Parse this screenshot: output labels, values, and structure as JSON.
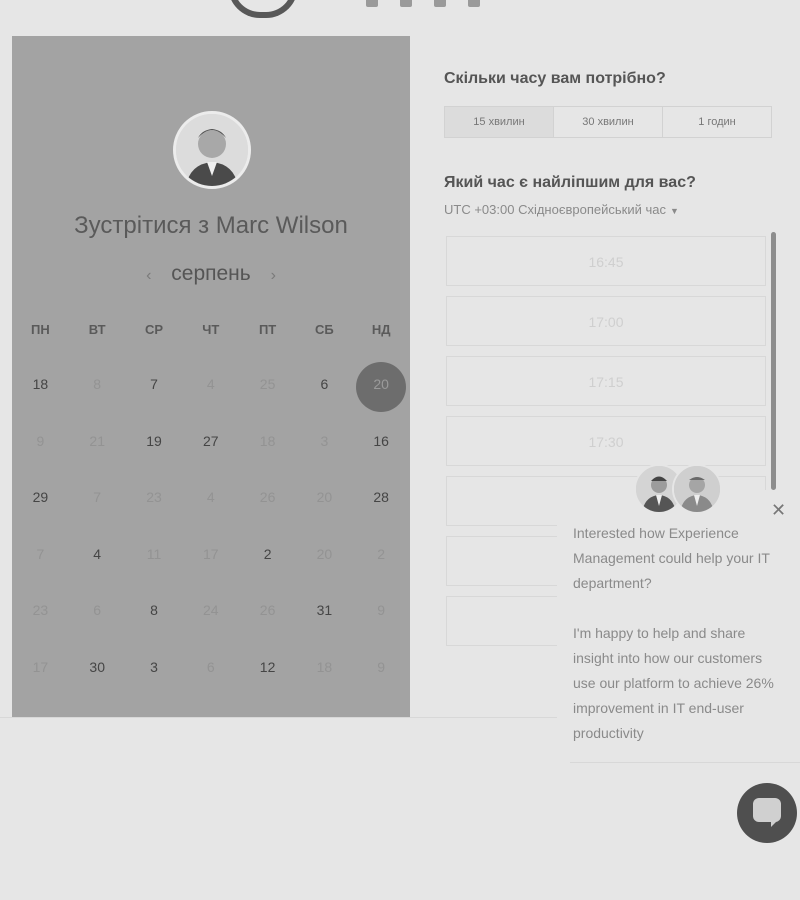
{
  "header": {
    "logo": "logo-icon"
  },
  "calendar": {
    "title": "Зустрітися з Marc Wilson",
    "month": "серпень",
    "prev": "‹",
    "next": "›",
    "weekdays": [
      "ПН",
      "ВТ",
      "СР",
      "ЧТ",
      "ПТ",
      "СБ",
      "НД"
    ],
    "weeks": [
      [
        {
          "d": "18",
          "s": "avail"
        },
        {
          "d": "8",
          "s": "dim"
        },
        {
          "d": "7",
          "s": "avail"
        },
        {
          "d": "4",
          "s": "dim"
        },
        {
          "d": "25",
          "s": "dim"
        },
        {
          "d": "6",
          "s": "avail"
        },
        {
          "d": "20",
          "s": "sel"
        }
      ],
      [
        {
          "d": "9",
          "s": "dim"
        },
        {
          "d": "21",
          "s": "dim"
        },
        {
          "d": "19",
          "s": "avail"
        },
        {
          "d": "27",
          "s": "avail"
        },
        {
          "d": "18",
          "s": "dim"
        },
        {
          "d": "3",
          "s": "dim"
        },
        {
          "d": "16",
          "s": "avail"
        }
      ],
      [
        {
          "d": "29",
          "s": "avail"
        },
        {
          "d": "7",
          "s": "dim"
        },
        {
          "d": "23",
          "s": "dim"
        },
        {
          "d": "4",
          "s": "dim"
        },
        {
          "d": "26",
          "s": "dim"
        },
        {
          "d": "20",
          "s": "dim"
        },
        {
          "d": "28",
          "s": "avail"
        }
      ],
      [
        {
          "d": "7",
          "s": "dim"
        },
        {
          "d": "4",
          "s": "avail"
        },
        {
          "d": "11",
          "s": "dim"
        },
        {
          "d": "17",
          "s": "dim"
        },
        {
          "d": "2",
          "s": "avail"
        },
        {
          "d": "20",
          "s": "dim"
        },
        {
          "d": "2",
          "s": "dim"
        }
      ],
      [
        {
          "d": "23",
          "s": "dim"
        },
        {
          "d": "6",
          "s": "dim"
        },
        {
          "d": "8",
          "s": "avail"
        },
        {
          "d": "24",
          "s": "dim"
        },
        {
          "d": "26",
          "s": "dim"
        },
        {
          "d": "31",
          "s": "avail"
        },
        {
          "d": "9",
          "s": "dim"
        }
      ],
      [
        {
          "d": "17",
          "s": "dim"
        },
        {
          "d": "30",
          "s": "avail"
        },
        {
          "d": "3",
          "s": "avail"
        },
        {
          "d": "6",
          "s": "dim"
        },
        {
          "d": "12",
          "s": "avail"
        },
        {
          "d": "18",
          "s": "dim"
        },
        {
          "d": "9",
          "s": "dim"
        }
      ]
    ]
  },
  "duration": {
    "question": "Скільки часу вам потрібно?",
    "options": [
      "15 хвилин",
      "30 хвилин",
      "1 годин"
    ]
  },
  "timeslots": {
    "question": "Який час є найліпшим для вас?",
    "timezone": "UTC +03:00 Східноєвропейський час",
    "times": [
      "16:45",
      "17:00",
      "17:15",
      "17:30",
      "",
      "",
      ""
    ]
  },
  "popup": {
    "message": "Interested how Experience Management could help your IT department?",
    "message2": "I'm happy to help and share insight into how our customers use our platform to achieve 26% improvement in IT end-user productivity",
    "close": "✕"
  }
}
